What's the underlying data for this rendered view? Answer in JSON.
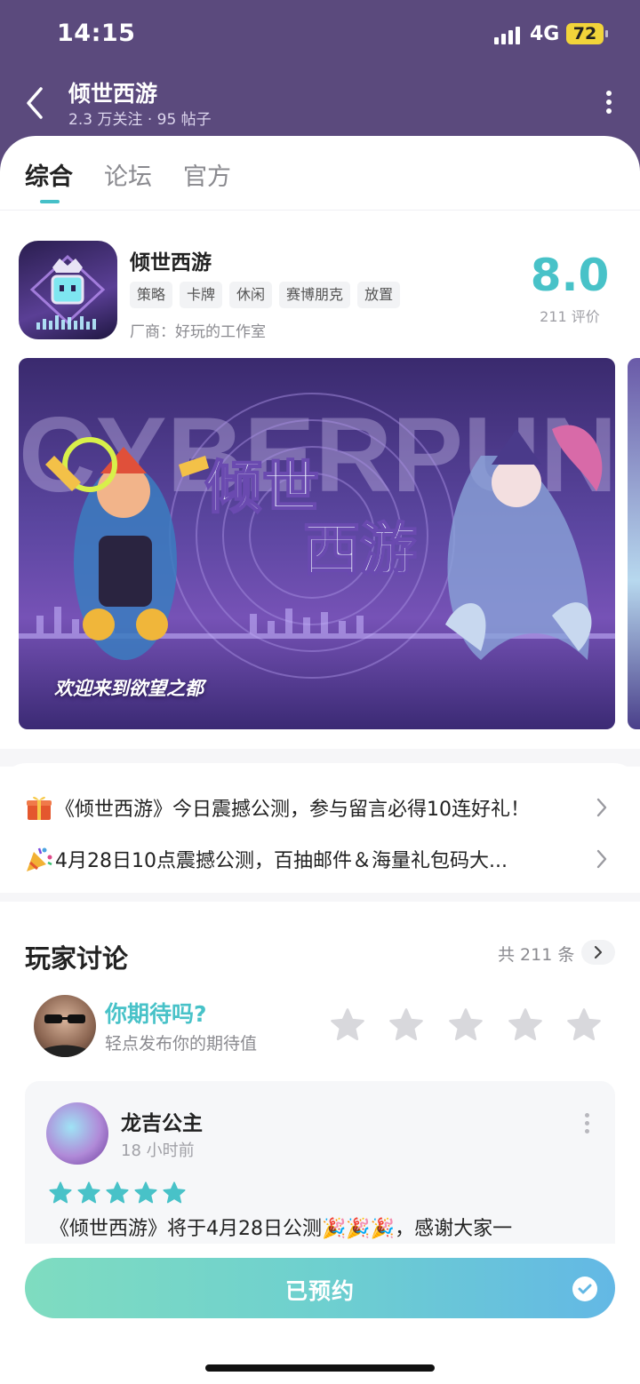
{
  "status": {
    "time": "14:15",
    "network": "4G",
    "battery": "72"
  },
  "header": {
    "title": "倾世西游",
    "subtitle": "2.3 万关注 · 95 帖子"
  },
  "tabs": [
    {
      "label": "综合",
      "active": true
    },
    {
      "label": "论坛",
      "active": false
    },
    {
      "label": "官方",
      "active": false
    }
  ],
  "game": {
    "name": "倾世西游",
    "tags": [
      "策略",
      "卡牌",
      "休闲",
      "赛博朋克",
      "放置"
    ],
    "maker": "厂商：好玩的工作室",
    "score": "8.0",
    "reviews": "211 评价",
    "banner_caption": "欢迎来到欲望之都",
    "banner_logo": "倾世西游",
    "banner_bg_text": "CYBERPUNK"
  },
  "notices": [
    {
      "icon": "gift-icon",
      "text": "《倾世西游》今日震撼公测，参与留言必得10连好礼！"
    },
    {
      "icon": "party-popper-icon",
      "text": "4月28日10点震撼公测，百抽邮件＆海量礼包码大..."
    }
  ],
  "discussion": {
    "title": "玩家讨论",
    "count": "共 211 条",
    "prompt": "你期待吗?",
    "hint": "轻点发布你的期待值",
    "rating_max": 5
  },
  "post": {
    "user": "龙吉公主",
    "time": "18 小时前",
    "rating": 5,
    "text": "《倾世西游》将于4月28日公测🎉🎉🎉，感谢大家一"
  },
  "action": {
    "reserve_label": "已预约"
  },
  "colors": {
    "accent": "#48c2c8",
    "header_bg": "#5b4a7d",
    "star_empty": "#d8d8dc"
  }
}
